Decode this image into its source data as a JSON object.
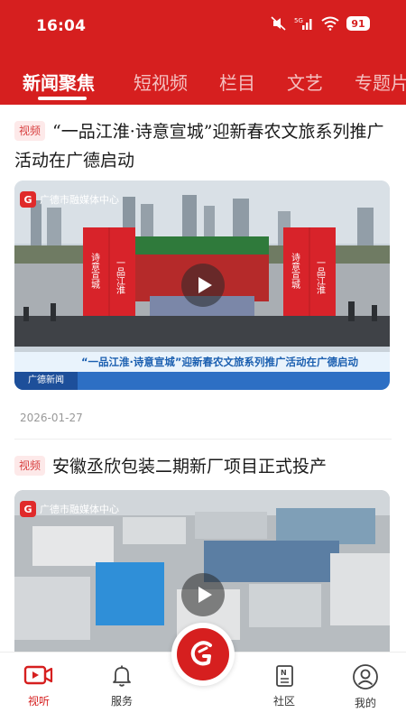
{
  "status_bar": {
    "time": "16:04",
    "battery": "91",
    "network": "5G"
  },
  "tabs": [
    {
      "label": "新闻聚焦",
      "active": true
    },
    {
      "label": "短视频"
    },
    {
      "label": "栏目"
    },
    {
      "label": "文艺"
    },
    {
      "label": "专题片"
    }
  ],
  "feed": [
    {
      "badge": "视频",
      "title": "“一品江淮·诗意宣城”迎新春农文旅系列推广活动在广德启动",
      "date": "2026-01-27",
      "media": {
        "logo_text": "广德市融媒体中心",
        "banner_left": "诗意宣城",
        "banner_right": "一品江淮",
        "banner_far_right": "诗意宣城",
        "banner_far_right_2": "一品江淮",
        "caption": "“一品江淮·诗意宣城”迎新春农文旅系列推广活动在广德启动",
        "caption_source": "广德新闻"
      }
    },
    {
      "badge": "视频",
      "title": "安徽丞欣包装二期新厂项目正式投产",
      "media": {
        "logo_text": "广德市融媒体中心"
      }
    }
  ],
  "bottom_nav": [
    {
      "label": "视听",
      "icon": "video-play-icon",
      "active": true
    },
    {
      "label": "服务",
      "icon": "bell-icon"
    },
    {
      "label": "",
      "icon": "center-logo-icon"
    },
    {
      "label": "社区",
      "icon": "news-document-icon"
    },
    {
      "label": "我的",
      "icon": "profile-icon"
    }
  ],
  "colors": {
    "brand": "#d61f1f",
    "badge_bg": "#fde9e9",
    "badge_text": "#d84040"
  }
}
